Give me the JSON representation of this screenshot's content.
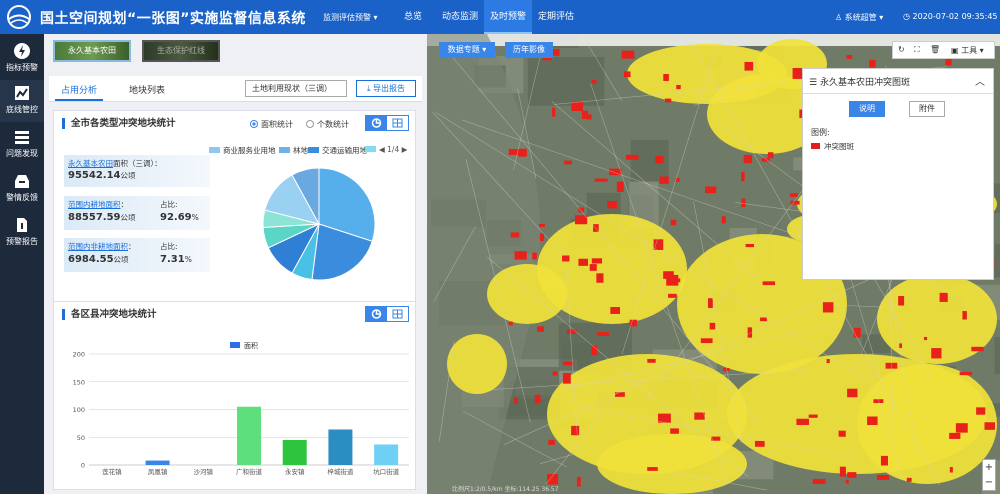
{
  "header": {
    "title": "国土空间规划“一张图”实施监督信息系统",
    "dropdown": "监测评估预警 ▾",
    "nav": [
      "总览",
      "动态监测",
      "及时预警",
      "定期评估"
    ],
    "user": "系统超管 ▾",
    "datetime": "2020-07-02  09:35:45"
  },
  "sidebar": {
    "items": [
      {
        "label": "指标预警",
        "icon": "lightning-icon"
      },
      {
        "label": "底线管控",
        "icon": "trend-icon"
      },
      {
        "label": "问题发现",
        "icon": "list-icon"
      },
      {
        "label": "警情反馈",
        "icon": "inbox-icon"
      },
      {
        "label": "预警报告",
        "icon": "document-icon"
      }
    ]
  },
  "layers": [
    "永久基本农田",
    "生态保护红线"
  ],
  "tabs": [
    "占用分析",
    "地块列表"
  ],
  "select_value": "土地利用现状（三调）",
  "export_label": "导出报告",
  "panel1": {
    "title": "全市各类型冲突地块统计",
    "radio": [
      "面积统计",
      "个数统计"
    ],
    "legend": [
      {
        "name": "商业服务业用地",
        "color": "#8fc7ef"
      },
      {
        "name": "林地",
        "color": "#6fb2e8"
      },
      {
        "name": "交通运输用地",
        "color": "#3b8cdd"
      },
      {
        "name": "",
        "color": "#7fdcf3"
      }
    ],
    "page": "1/4",
    "stats": [
      {
        "label": "永久基本农田",
        "label_suffix": "面积（三调）：",
        "value": "95542.14",
        "unit": "公顷"
      },
      {
        "label": "范围内耕地面积",
        "label_suffix": "：",
        "value": "88557.59",
        "unit": "公顷",
        "ratio_label": "占比:",
        "ratio": "92.69",
        "ratio_unit": "%"
      },
      {
        "label": "范围内非耕地面积",
        "label_suffix": "：",
        "value": "6984.55",
        "unit": "公顷",
        "ratio_label": "占比:",
        "ratio": "7.31",
        "ratio_unit": "%"
      }
    ]
  },
  "pie_colors": [
    "#56aeea",
    "#3b8cdd",
    "#4ac0e6",
    "#2f7fd4",
    "#5bd6c6",
    "#8de3d6",
    "#9ad0f2",
    "#6aa8e0"
  ],
  "panel2": {
    "title": "各区县冲突地块统计",
    "legend": "面积"
  },
  "chart_data": {
    "type": "bar",
    "categories": [
      "莲花镇",
      "凤凰镇",
      "沙河镇",
      "广和街道",
      "永安镇",
      "梓城街道",
      "坑口街道"
    ],
    "values": [
      0,
      8,
      0,
      105,
      45,
      64,
      37
    ],
    "colors": [
      "#3a86e8",
      "#3a86e8",
      "#3a86e8",
      "#5de07c",
      "#2ec43e",
      "#2a8ec2",
      "#6fd0f5"
    ],
    "ylim": [
      0,
      200
    ],
    "yticks": [
      0,
      50,
      100,
      150,
      200
    ],
    "series": [
      {
        "name": "面积",
        "values": [
          0,
          8,
          0,
          105,
          45,
          64,
          37
        ]
      }
    ]
  },
  "map": {
    "buttons": [
      "数据专题 ▾",
      "历年影像"
    ],
    "tools": "工具 ▾",
    "info_title": "永久基本农田冲突图斑",
    "info_btn1": "说明",
    "info_btn2": "附件",
    "legend_title": "图例:",
    "legend_item": "冲突图斑",
    "scale": "比例尺1:2/0.5/km  坐标:114.25  36.57"
  }
}
